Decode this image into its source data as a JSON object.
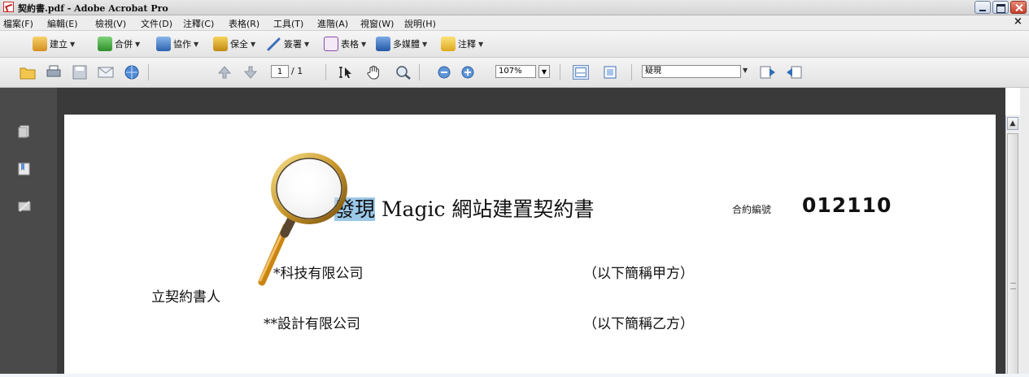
{
  "window": {
    "title": "契約書.pdf - Adobe Acrobat Pro",
    "icon": "pdf-file-icon"
  },
  "menu": {
    "items": [
      "檔案(F)",
      "編輯(E)",
      "檢視(V)",
      "文件(D)",
      "注釋(C)",
      "表格(R)",
      "工具(T)",
      "進階(A)",
      "視窗(W)",
      "說明(H)"
    ],
    "close": "×"
  },
  "tasks": [
    {
      "label": "建立",
      "icon": "create-pdf-icon"
    },
    {
      "label": "合併",
      "icon": "combine-icon"
    },
    {
      "label": "協作",
      "icon": "collaborate-icon"
    },
    {
      "label": "保全",
      "icon": "secure-lock-icon"
    },
    {
      "label": "簽署",
      "icon": "sign-pen-icon"
    },
    {
      "label": "表格",
      "icon": "forms-icon"
    },
    {
      "label": "多媒體",
      "icon": "multimedia-icon"
    },
    {
      "label": "注釋",
      "icon": "comment-icon"
    }
  ],
  "toolbar": {
    "page_current": "1",
    "page_total": "/ 1",
    "zoom": "107%",
    "find_text": "疑現",
    "colors": {
      "accent": "#2f6db5",
      "highlight": "#9bc8e8"
    }
  },
  "document": {
    "title_highlight": "發現",
    "title_rest": " Magic 網站建置契約書",
    "contract_label": "合約編號",
    "contract_number": "012110",
    "party_a": "*科技有限公司",
    "party_a_note": "（以下簡稱甲方）",
    "signer_label": "立契約書人",
    "party_b": "**設計有限公司",
    "party_b_note": "（以下簡稱乙方）"
  }
}
